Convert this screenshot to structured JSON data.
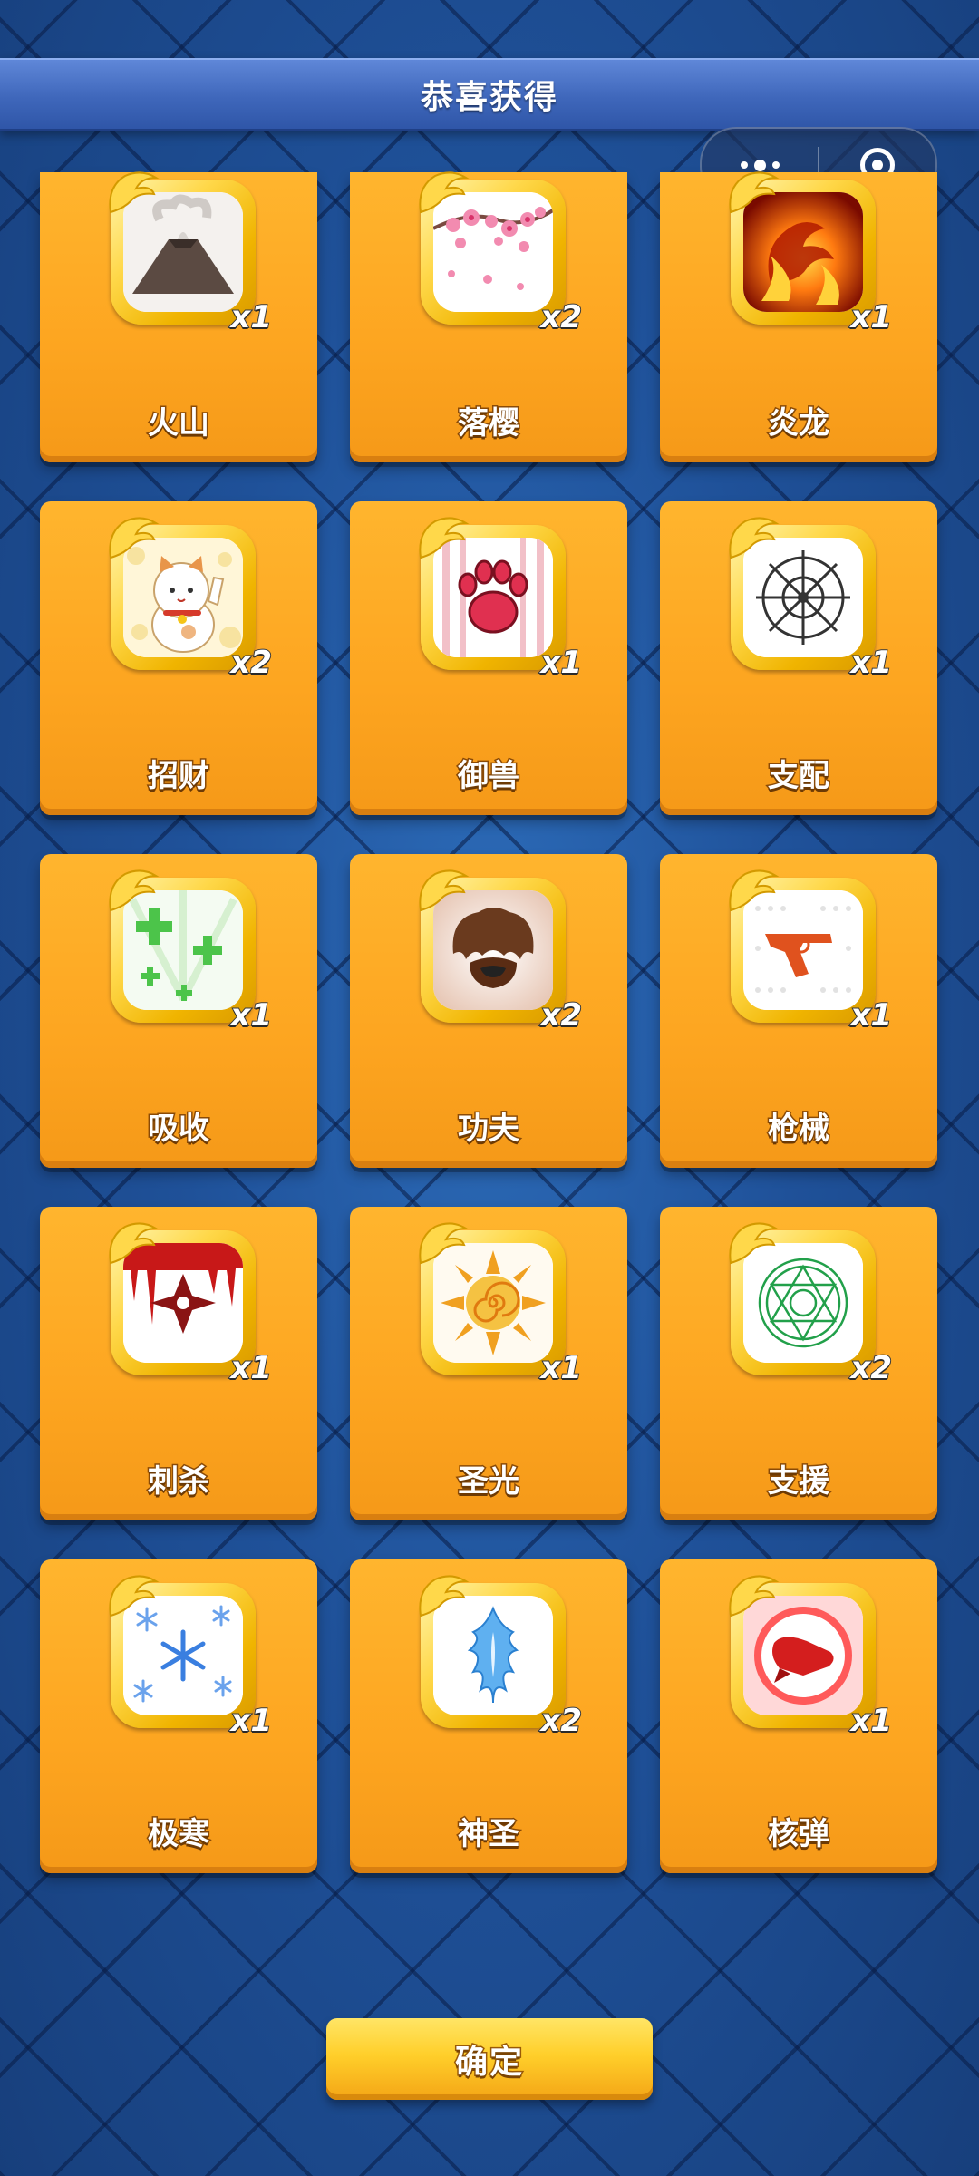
{
  "header": {
    "title": "恭喜获得"
  },
  "capsule": {
    "menu_icon": "more-dots-icon",
    "close_icon": "target-circle-icon"
  },
  "rewards": [
    {
      "name": "火山",
      "qty": "x1",
      "icon": "volcano-icon"
    },
    {
      "name": "落樱",
      "qty": "x2",
      "icon": "cherry-blossom-icon"
    },
    {
      "name": "炎龙",
      "qty": "x1",
      "icon": "fire-dragon-icon"
    },
    {
      "name": "招财",
      "qty": "x2",
      "icon": "lucky-cat-icon"
    },
    {
      "name": "御兽",
      "qty": "x1",
      "icon": "paw-icon"
    },
    {
      "name": "支配",
      "qty": "x1",
      "icon": "wheel-web-icon"
    },
    {
      "name": "吸收",
      "qty": "x1",
      "icon": "green-plus-icon"
    },
    {
      "name": "功夫",
      "qty": "x2",
      "icon": "kungfu-hair-icon"
    },
    {
      "name": "枪械",
      "qty": "x1",
      "icon": "revolver-icon"
    },
    {
      "name": "刺杀",
      "qty": "x1",
      "icon": "bloody-shuriken-icon"
    },
    {
      "name": "圣光",
      "qty": "x1",
      "icon": "sun-spiral-icon"
    },
    {
      "name": "支援",
      "qty": "x2",
      "icon": "magic-circle-icon"
    },
    {
      "name": "极寒",
      "qty": "x1",
      "icon": "snowflake-icon"
    },
    {
      "name": "神圣",
      "qty": "x2",
      "icon": "holy-blue-crest-icon"
    },
    {
      "name": "核弹",
      "qty": "x1",
      "icon": "nuke-missile-icon"
    }
  ],
  "confirm": {
    "label": "确定"
  }
}
